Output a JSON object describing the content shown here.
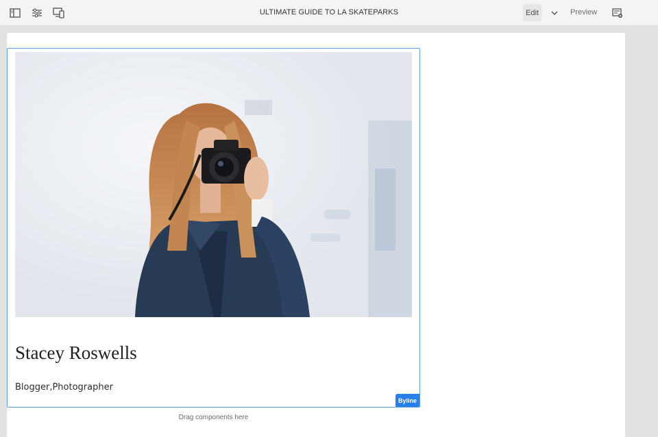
{
  "toolbar": {
    "title": "ULTIMATE GUIDE TO LA SKATEPARKS",
    "icons": [
      "side-panel-icon",
      "page-properties-icon",
      "emulator-icon"
    ],
    "edit_label": "Edit",
    "mode_dropdown_icon": "chevron-down-icon",
    "preview_label": "Preview",
    "annotations_icon": "annotate-icon"
  },
  "byline": {
    "image_alt": "Woman holding a camera",
    "name": "Stacey Roswells",
    "occupations": "Blogger,Photographer",
    "component_label": "Byline"
  },
  "dropzone": {
    "placeholder": "Drag components here"
  },
  "colors": {
    "accent": "#2680eb",
    "selection_border": "#5aa1ee",
    "toolbar_bg": "#f4f4f4"
  }
}
